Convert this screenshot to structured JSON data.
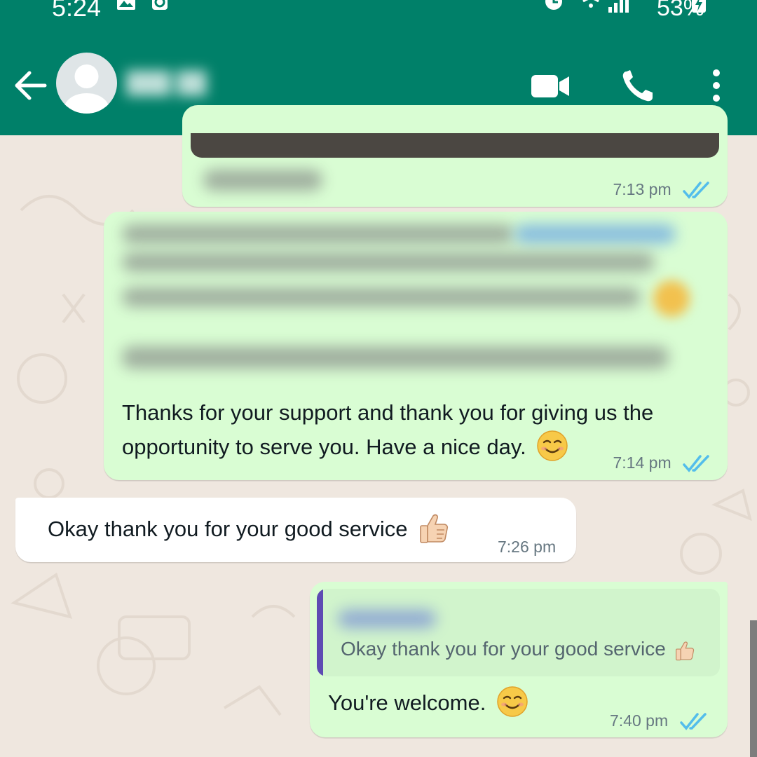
{
  "status_bar": {
    "time": "5:24",
    "battery": "53%"
  },
  "header": {
    "contact_name": ""
  },
  "messages": [
    {
      "id": "m1",
      "direction": "outgoing",
      "text": "",
      "time": "7:13 pm",
      "read": true
    },
    {
      "id": "m2",
      "direction": "outgoing",
      "text": "Thanks for your support and thank you for giving us the opportunity to serve you. Have a nice day.",
      "emoji": "smiling-face-icon",
      "time": "7:14 pm",
      "read": true
    },
    {
      "id": "m3",
      "direction": "incoming",
      "text": "Okay thank you for your good service",
      "emoji": "thumbs-up-icon",
      "time": "7:26 pm"
    },
    {
      "id": "m4",
      "direction": "outgoing",
      "quoted_text": "Okay thank you for your good service",
      "text": "You're welcome.",
      "emoji": "smiling-face-icon",
      "time": "7:40 pm",
      "read": true
    }
  ],
  "colors": {
    "header": "#008069",
    "outgoing_bubble": "#d9fdd3",
    "incoming_bubble": "#ffffff",
    "read_ticks": "#53bdeb",
    "quote_bar": "#5e4bb3"
  }
}
